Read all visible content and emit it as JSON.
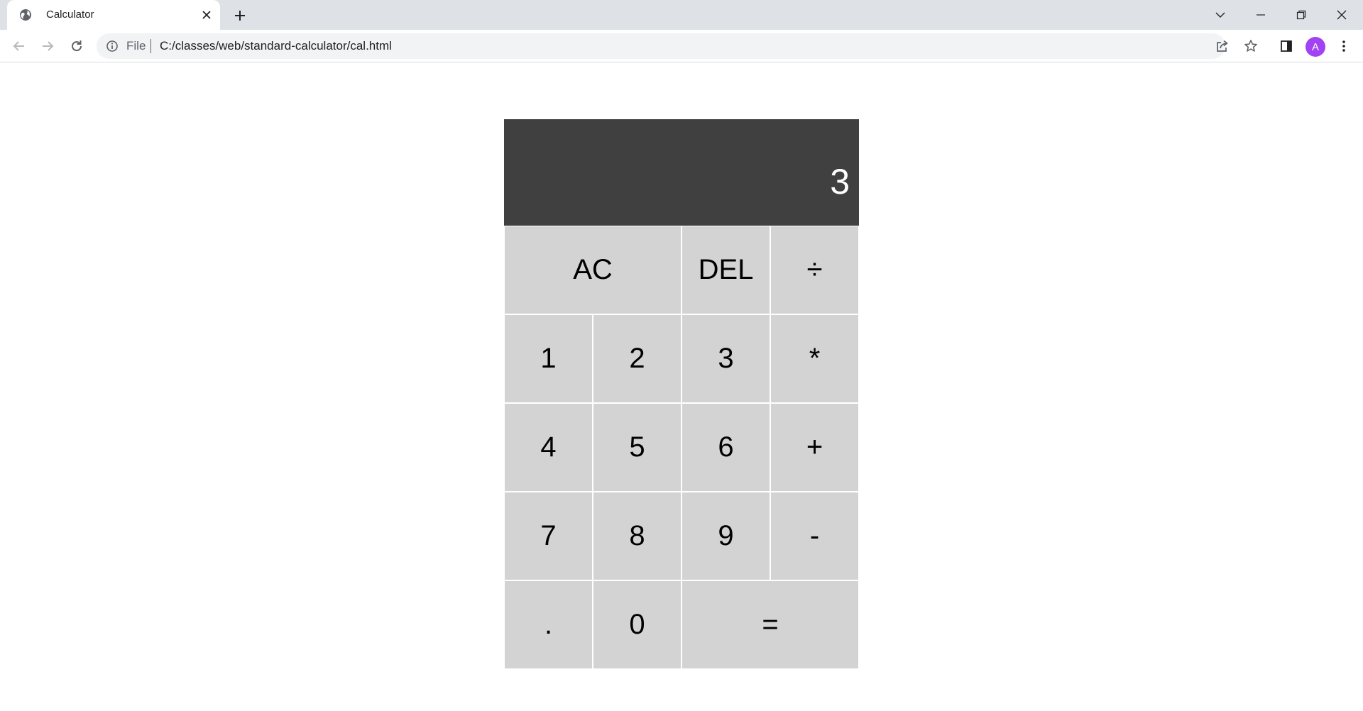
{
  "browser": {
    "tab": {
      "title": "Calculator",
      "favicon": "globe-icon",
      "close_icon": "close-icon"
    },
    "new_tab_icon": "plus-icon",
    "window_controls": [
      "chevron-down-icon",
      "minimize-icon",
      "restore-icon",
      "close-icon"
    ],
    "toolbar": {
      "back_icon": "arrow-left-icon",
      "forward_icon": "arrow-right-icon",
      "reload_icon": "reload-icon",
      "omnibox": {
        "info_icon": "info-icon",
        "scheme_label": "File",
        "url": "C:/classes/web/standard-calculator/cal.html",
        "share_icon": "share-icon",
        "bookmark_icon": "star-icon"
      },
      "side_panel_icon": "side-panel-icon",
      "profile_initial": "A",
      "menu_icon": "kebab-menu-icon"
    },
    "colors": {
      "tabstrip": "#dee1e6",
      "avatar": "#a142f4",
      "icon": "#5f6368"
    }
  },
  "calculator": {
    "display": {
      "value": "3"
    },
    "keys": [
      {
        "label": "AC",
        "name": "all-clear-button",
        "wide": true
      },
      {
        "label": "DEL",
        "name": "delete-button",
        "wide": false
      },
      {
        "label": "÷",
        "name": "divide-button",
        "wide": false
      },
      {
        "label": "1",
        "name": "digit-1-button",
        "wide": false
      },
      {
        "label": "2",
        "name": "digit-2-button",
        "wide": false
      },
      {
        "label": "3",
        "name": "digit-3-button",
        "wide": false
      },
      {
        "label": "*",
        "name": "multiply-button",
        "wide": false
      },
      {
        "label": "4",
        "name": "digit-4-button",
        "wide": false
      },
      {
        "label": "5",
        "name": "digit-5-button",
        "wide": false
      },
      {
        "label": "6",
        "name": "digit-6-button",
        "wide": false
      },
      {
        "label": "+",
        "name": "add-button",
        "wide": false
      },
      {
        "label": "7",
        "name": "digit-7-button",
        "wide": false
      },
      {
        "label": "8",
        "name": "digit-8-button",
        "wide": false
      },
      {
        "label": "9",
        "name": "digit-9-button",
        "wide": false
      },
      {
        "label": "-",
        "name": "subtract-button",
        "wide": false
      },
      {
        "label": ".",
        "name": "decimal-button",
        "wide": false
      },
      {
        "label": "0",
        "name": "digit-0-button",
        "wide": false
      },
      {
        "label": "=",
        "name": "equals-button",
        "wide": true
      }
    ],
    "colors": {
      "display_bg": "#404040",
      "display_text": "#ffffff",
      "key_bg": "#d3d3d3",
      "key_border": "#ffffff",
      "key_text": "#000000"
    }
  }
}
